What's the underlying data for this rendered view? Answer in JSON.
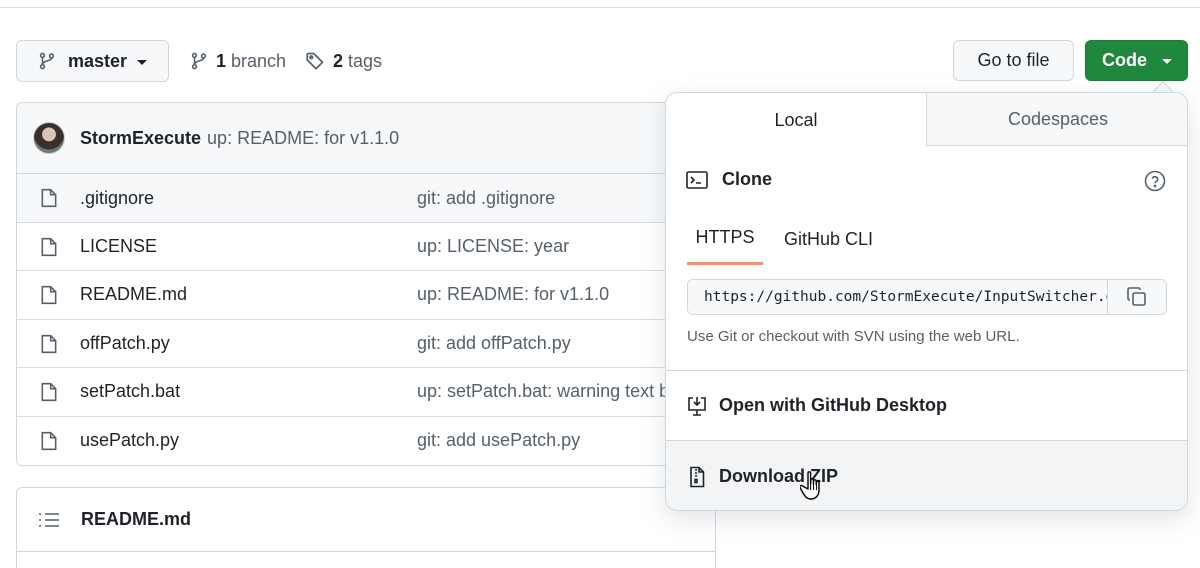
{
  "repo_nav": {
    "branch_selector": "master",
    "branches_count": "1",
    "branches_label": "branch",
    "tags_count": "2",
    "tags_label": "tags",
    "goto_file_label": "Go to file",
    "code_label": "Code"
  },
  "commit": {
    "author": "StormExecute",
    "message": "up: README: for v1.1.0"
  },
  "files": [
    {
      "name": ".gitignore",
      "message": "git: add .gitignore"
    },
    {
      "name": "LICENSE",
      "message": "up: LICENSE: year"
    },
    {
      "name": "README.md",
      "message": "up: README: for v1.1.0"
    },
    {
      "name": "offPatch.py",
      "message": "git: add offPatch.py"
    },
    {
      "name": "setPatch.bat",
      "message": "up: setPatch.bat: warning text b"
    },
    {
      "name": "usePatch.py",
      "message": "git: add usePatch.py"
    }
  ],
  "readme": {
    "title": "README.md"
  },
  "code_popup": {
    "tabs": [
      "Local",
      "Codespaces"
    ],
    "clone_title": "Clone",
    "subtabs": [
      "HTTPS",
      "GitHub CLI"
    ],
    "clone_url": "https://github.com/StormExecute/InputSwitcher.git",
    "hint": "Use Git or checkout with SVN using the web URL.",
    "open_desktop": "Open with GitHub Desktop",
    "download_zip": "Download ZIP"
  },
  "colors": {
    "primary_green": "#1f883d",
    "tab_underline": "#fd8c73",
    "border": "#d0d7de",
    "muted_text": "#57606a"
  },
  "icons": [
    "git-branch-icon",
    "tag-icon",
    "file-icon",
    "list-unordered-icon",
    "terminal-icon",
    "question-icon",
    "copy-icon",
    "desktop-download-icon",
    "file-zip-icon",
    "hand-pointer-cursor"
  ]
}
